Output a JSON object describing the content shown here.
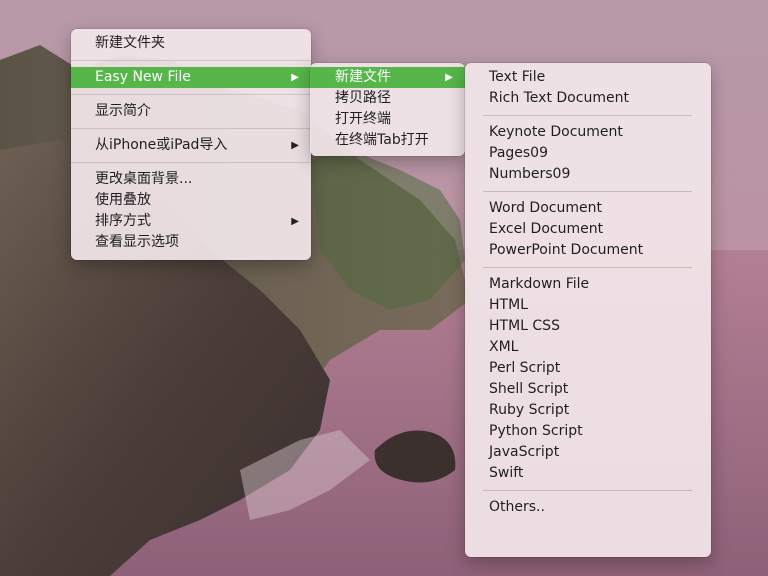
{
  "main_menu": {
    "items": [
      {
        "label": "新建文件夹",
        "submenu": false
      },
      {
        "label": "Easy New File",
        "submenu": true,
        "active": true
      },
      {
        "label": "显示简介",
        "submenu": false
      },
      {
        "label": "从iPhone或iPad导入",
        "submenu": true
      },
      {
        "label": "更改桌面背景...",
        "submenu": false
      },
      {
        "label": "使用叠放",
        "submenu": false
      },
      {
        "label": "排序方式",
        "submenu": true
      },
      {
        "label": "查看显示选项",
        "submenu": false
      }
    ]
  },
  "easy_new_file_menu": {
    "items": [
      {
        "label": "新建文件",
        "submenu": true,
        "active": true
      },
      {
        "label": "拷贝路径",
        "submenu": false
      },
      {
        "label": "打开终端",
        "submenu": false
      },
      {
        "label": "在终端Tab打开",
        "submenu": false
      }
    ]
  },
  "new_file_menu": {
    "groups": [
      [
        "Text File",
        "Rich Text Document"
      ],
      [
        "Keynote Document",
        "Pages09",
        "Numbers09"
      ],
      [
        "Word Document",
        "Excel Document",
        "PowerPoint Document"
      ],
      [
        "Markdown File",
        "HTML",
        "HTML CSS",
        "XML",
        "Perl Script",
        "Shell Script",
        "Ruby Script",
        "Python Script",
        "JavaScript",
        "Swift"
      ],
      [
        "Others.."
      ]
    ]
  },
  "colors": {
    "highlight": "#56b649",
    "menu_bg": "#f2e6ea",
    "sky": "#b7879a",
    "sea": "#9d6f86"
  },
  "icons": {
    "submenu_arrow": "▶"
  }
}
